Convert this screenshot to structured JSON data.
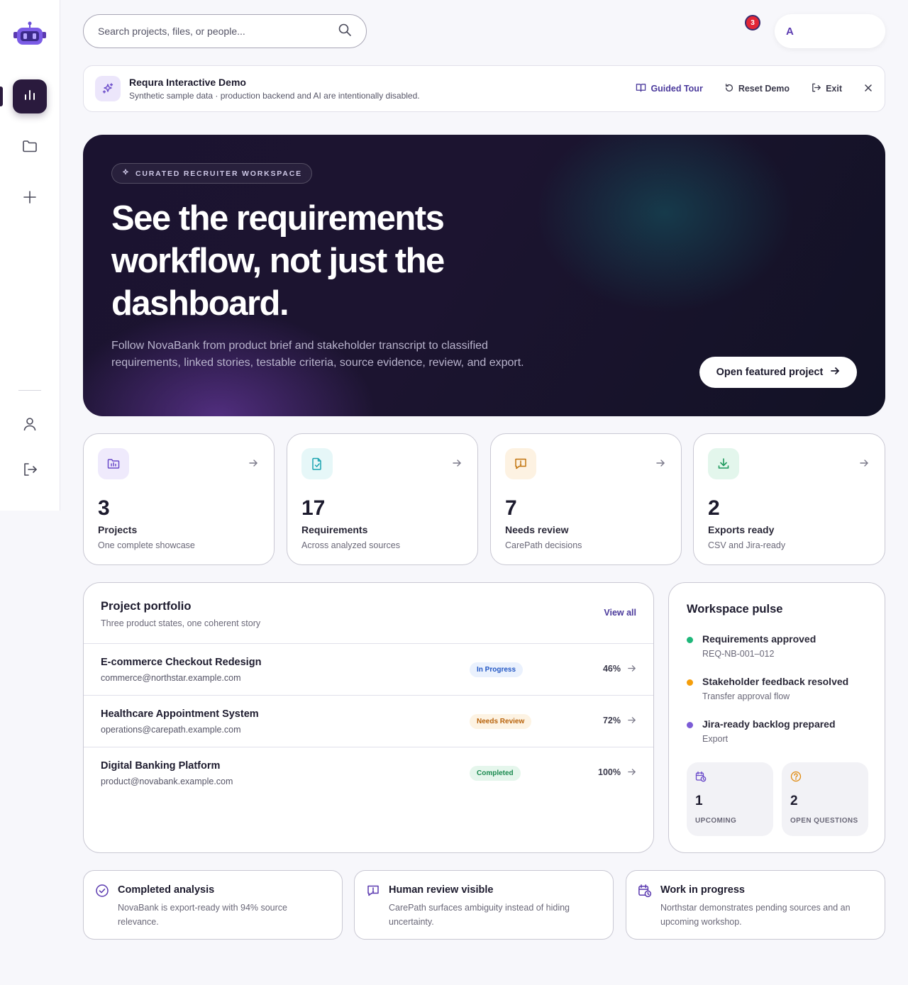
{
  "search": {
    "placeholder": "Search projects, files, or people..."
  },
  "notifications": {
    "count": "3"
  },
  "user": {
    "initial": "A"
  },
  "banner": {
    "title": "Requra Interactive Demo",
    "subtitle": "Synthetic sample data · production backend and AI are intentionally disabled.",
    "guided_tour": "Guided Tour",
    "reset_demo": "Reset Demo",
    "exit": "Exit"
  },
  "hero": {
    "pill": "CURATED RECRUITER WORKSPACE",
    "title": "See the requirements workflow, not just the dashboard.",
    "description": "Follow NovaBank from product brief and stakeholder transcript to classified requirements, linked stories, testable criteria, source evidence, review, and export.",
    "cta": "Open featured project"
  },
  "stats": [
    {
      "value": "3",
      "label": "Projects",
      "sub": "One complete showcase"
    },
    {
      "value": "17",
      "label": "Requirements",
      "sub": "Across analyzed sources"
    },
    {
      "value": "7",
      "label": "Needs review",
      "sub": "CarePath decisions"
    },
    {
      "value": "2",
      "label": "Exports ready",
      "sub": "CSV and Jira-ready"
    }
  ],
  "portfolio": {
    "title": "Project portfolio",
    "subtitle": "Three product states, one coherent story",
    "view_all": "View all",
    "rows": [
      {
        "name": "E-commerce Checkout Redesign",
        "email": "commerce@northstar.example.com",
        "status": "In Progress",
        "progress": "46%"
      },
      {
        "name": "Healthcare Appointment System",
        "email": "operations@carepath.example.com",
        "status": "Needs Review",
        "progress": "72%"
      },
      {
        "name": "Digital Banking Platform",
        "email": "product@novabank.example.com",
        "status": "Completed",
        "progress": "100%"
      }
    ]
  },
  "pulse": {
    "title": "Workspace pulse",
    "items": [
      {
        "name": "Requirements approved",
        "sub": "REQ-NB-001–012",
        "color": "#1fb77a"
      },
      {
        "name": "Stakeholder feedback resolved",
        "sub": "Transfer approval flow",
        "color": "#f59e0b"
      },
      {
        "name": "Jira-ready backlog prepared",
        "sub": "Export",
        "color": "#7c5cd6"
      }
    ],
    "upcoming": {
      "value": "1",
      "label": "UPCOMING"
    },
    "questions": {
      "value": "2",
      "label": "OPEN QUESTIONS"
    }
  },
  "features": [
    {
      "title": "Completed analysis",
      "desc": "NovaBank is export-ready with 94% source relevance."
    },
    {
      "title": "Human review visible",
      "desc": "CarePath surfaces ambiguity instead of hiding uncertainty."
    },
    {
      "title": "Work in progress",
      "desc": "Northstar demonstrates pending sources and an upcoming workshop."
    }
  ],
  "colors": {
    "brand": "#2a1a3d",
    "accent": "#4b3a9c"
  }
}
